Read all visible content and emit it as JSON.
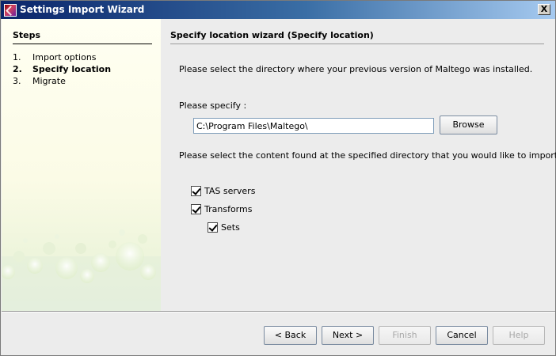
{
  "window": {
    "title": "Settings Import Wizard",
    "close_label": "X"
  },
  "steps": {
    "title": "Steps",
    "items": [
      {
        "num": "1.",
        "label": "Import options"
      },
      {
        "num": "2.",
        "label": "Specify location"
      },
      {
        "num": "3.",
        "label": "Migrate"
      }
    ],
    "current_index": 1
  },
  "content": {
    "title": "Specify location wizard (Specify location)",
    "instruction": "Please select the directory where your previous version of Maltego was installed.",
    "specify_label": "Please specify :",
    "path_value": "C:\\Program Files\\Maltego\\",
    "browse_label": "Browse",
    "content_instruction": "Please select the content found at the specified directory that you would like to import.",
    "options": [
      {
        "label": "TAS servers",
        "checked": true,
        "level": 0
      },
      {
        "label": "Transforms",
        "checked": true,
        "level": 0
      },
      {
        "label": "Sets",
        "checked": true,
        "level": 1
      }
    ]
  },
  "buttons": {
    "back": "< Back",
    "next": "Next >",
    "finish": "Finish",
    "cancel": "Cancel",
    "help": "Help"
  },
  "colors": {
    "titlebar_start": "#0a246a",
    "titlebar_end": "#a6caf0",
    "steps_background": "#fffff2",
    "window_background": "#ececec"
  },
  "icons": {
    "title": "maltego-app-icon",
    "close": "close-icon",
    "checkbox": "checkbox-checked-icon"
  }
}
